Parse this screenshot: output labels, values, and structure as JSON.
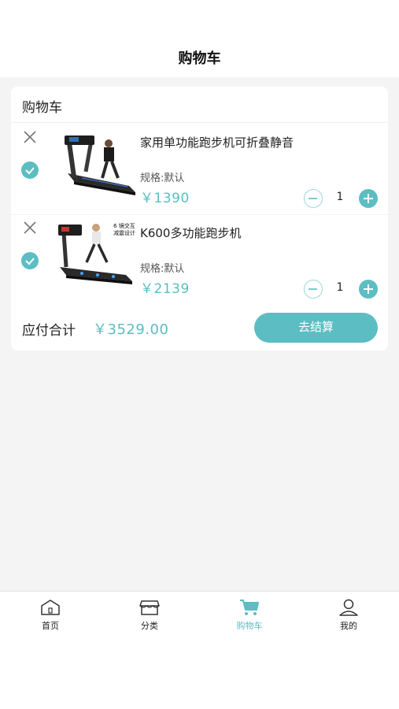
{
  "header": {
    "title": "购物车"
  },
  "cart": {
    "title": "购物车",
    "items": [
      {
        "name": "家用单功能跑步机可折叠静音",
        "spec": "规格:默认",
        "price": "￥1390",
        "quantity": "1",
        "checked": true
      },
      {
        "name": "K600多功能跑步机",
        "spec": "规格:默认",
        "price": "￥2139",
        "quantity": "1",
        "checked": true,
        "image_text": [
          "6 镜交互",
          "减震设计"
        ]
      }
    ],
    "total_label": "应付合计",
    "total_value": "￥3529.00",
    "checkout_label": "去结算"
  },
  "tabbar": {
    "tabs": [
      {
        "label": "首页",
        "icon": "home-icon",
        "active": false
      },
      {
        "label": "分类",
        "icon": "store-icon",
        "active": false
      },
      {
        "label": "购物车",
        "icon": "cart-icon",
        "active": true
      },
      {
        "label": "我的",
        "icon": "user-icon",
        "active": false
      }
    ]
  },
  "colors": {
    "accent": "#5cbdc2",
    "background": "#f4f4f4",
    "text": "#222222"
  }
}
